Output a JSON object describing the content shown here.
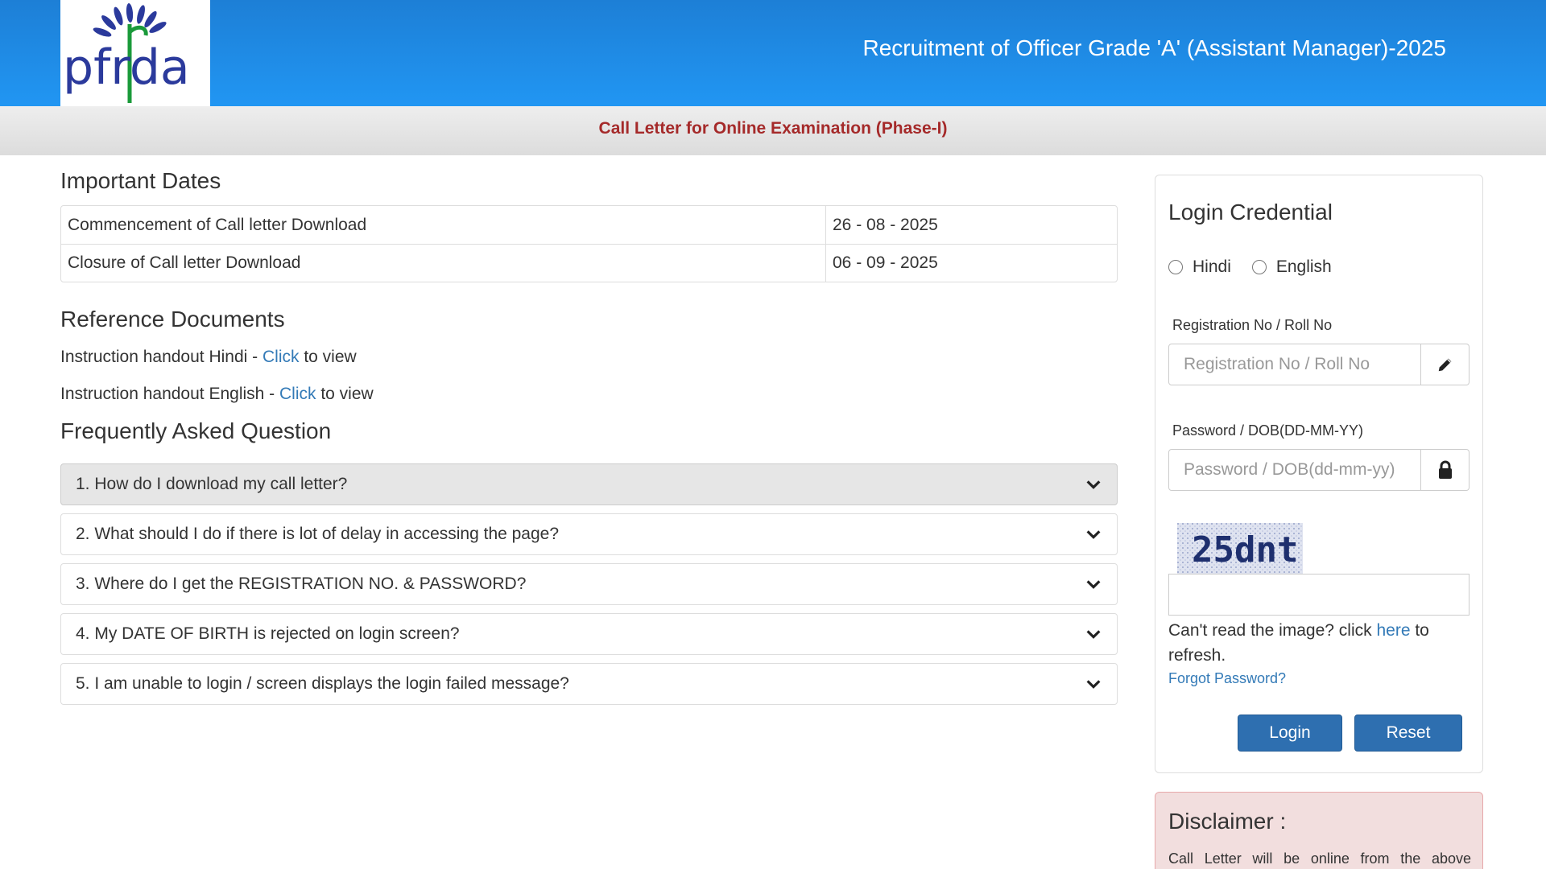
{
  "header": {
    "title": "Recruitment of Officer Grade 'A' (Assistant Manager)-2025",
    "logo_text": "pfrda",
    "bg_color": "#2196f3"
  },
  "subheader": {
    "text": "Call Letter for Online Examination (Phase-I)",
    "color": "#a52a2a"
  },
  "important_dates": {
    "title": "Important Dates",
    "rows": [
      {
        "label": "Commencement of Call letter Download",
        "value": "26 - 08 - 2025"
      },
      {
        "label": "Closure of Call letter Download",
        "value": "06 - 09 - 2025"
      }
    ]
  },
  "reference": {
    "title": "Reference Documents",
    "items": [
      {
        "prefix": "Instruction handout Hindi - ",
        "link": "Click",
        "suffix": " to view"
      },
      {
        "prefix": "Instruction handout English - ",
        "link": "Click",
        "suffix": " to view"
      }
    ]
  },
  "faq": {
    "title": "Frequently Asked Question",
    "items": [
      {
        "q": "1. How do I download my call letter?"
      },
      {
        "q": "2. What should I do if there is lot of delay in accessing the page?"
      },
      {
        "q": "3. Where do I get the REGISTRATION NO. & PASSWORD?"
      },
      {
        "q": "4. My DATE OF BIRTH is rejected on login screen?"
      },
      {
        "q": "5. I am unable to login / screen displays the login failed message?"
      }
    ]
  },
  "login": {
    "title": "Login Credential",
    "lang_options": [
      "Hindi",
      "English"
    ],
    "reg_label": "Registration No / Roll No",
    "reg_placeholder": "Registration No / Roll No",
    "pwd_label": "Password / DOB(DD-MM-YY)",
    "pwd_placeholder": "Password / DOB(dd-mm-yy)",
    "captcha_text": "25dnt",
    "cant_read_prefix": "Can't read the image? click ",
    "cant_read_link": "here",
    "cant_read_suffix": " to refresh.",
    "forgot": "Forgot Password?",
    "login_btn": "Login",
    "reset_btn": "Reset",
    "btn_color": "#2e6fb0"
  },
  "disclaimer": {
    "title": "Disclaimer :",
    "text": "Call Letter will be online from the above"
  }
}
